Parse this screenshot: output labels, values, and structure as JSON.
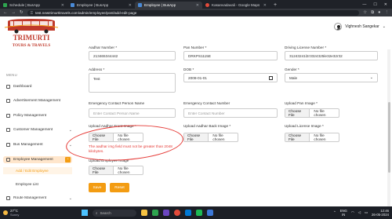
{
  "browser": {
    "tabs": [
      {
        "label": "Schedule | BusApp",
        "active": false
      },
      {
        "label": "Employee | BusApp",
        "active": false
      },
      {
        "label": "Employee | BusApp",
        "active": true
      },
      {
        "label": "Kasanvadavali - Google Maps",
        "active": false
      }
    ],
    "url": "test.newtrimurtitravels.com/admin/employee/post/add-edit-page"
  },
  "brand": {
    "line1": "TRIMURTI",
    "line2": "TOURS & TRAVELS"
  },
  "user": {
    "name": "Vighnesh Sangekar",
    "caret": "⌄"
  },
  "sidebar": {
    "heading": "MENU",
    "items": [
      {
        "label": "Dashboard",
        "icon": "dashboard-icon"
      },
      {
        "label": "Advertisement Management",
        "icon": "advertisement-icon"
      },
      {
        "label": "Policy Management",
        "icon": "policy-icon"
      },
      {
        "label": "Customer Management",
        "icon": "customer-icon",
        "chevron": "⌄"
      },
      {
        "label": "Bus Management",
        "icon": "bus-icon",
        "chevron": "⌄"
      },
      {
        "label": "Employee Management",
        "icon": "employee-icon",
        "chevron": "⌃"
      },
      {
        "label": "Route Management",
        "icon": "route-icon",
        "chevron": "⌄"
      }
    ],
    "sub_items": [
      {
        "label": "Add / Edit Employee",
        "active": true
      },
      {
        "label": "Employee List",
        "active": false
      }
    ]
  },
  "form": {
    "aadhar_number": {
      "label": "Aadhar Number *",
      "value": "213465344442"
    },
    "pan_number": {
      "label": "Pan Number *",
      "value": "DRKPS1115E"
    },
    "driving_license": {
      "label": "Driving License Number *",
      "value": "31243241l2r3324325le32e32r32"
    },
    "address": {
      "label": "Address *",
      "value": "Test"
    },
    "dob": {
      "label": "DOB *",
      "value": "2008-01-01"
    },
    "gender": {
      "label": "Gender *",
      "value": "Male"
    },
    "emergency_name": {
      "label": "Emergency Contact Person Name",
      "placeholder": "Enter Contact Person Name"
    },
    "emergency_number": {
      "label": "Emergency Contact Number",
      "placeholder": "Enter Contact Number"
    },
    "upload_pan": {
      "label": "Upload Pan Image *"
    },
    "upload_aadhar_front": {
      "label": "Upload Aadhar Front Image *",
      "error": "The aadhar img field must not be greater than 2048 kilobytes."
    },
    "upload_aadhar_back": {
      "label": "Upload Aadhar Back Image *"
    },
    "upload_license": {
      "label": "Upload License Image *"
    },
    "upload_employee": {
      "label": "Upload Employee Image"
    },
    "choose_file_label": "Choose File",
    "no_file_label": "No file chosen",
    "save_label": "Save",
    "reset_label": "Reset"
  },
  "taskbar": {
    "weather_temp": "27°C",
    "weather_desc": "Sunny",
    "search_placeholder": "Search",
    "lang_top": "ENG",
    "lang_bottom": "IN",
    "time": "12:46",
    "date": "26-05-2024"
  },
  "colors": {
    "accent": "#f39c12",
    "error": "#e53935",
    "brand_red": "#c0392b"
  }
}
